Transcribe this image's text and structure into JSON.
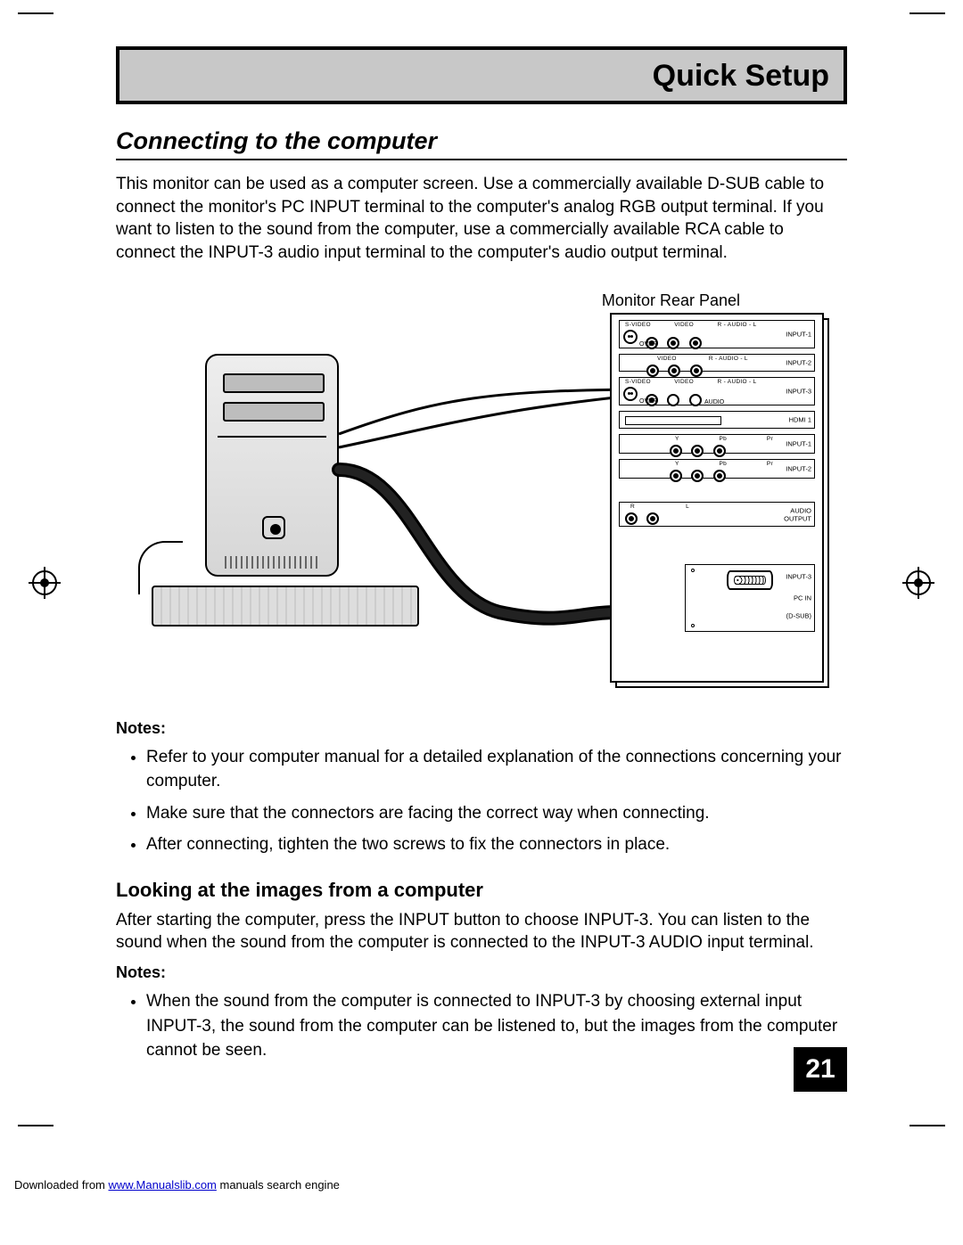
{
  "title_bar": "Quick Setup",
  "heading1": "Connecting to the computer",
  "intro": "This monitor can be used as a computer screen.  Use a commercially available D-SUB cable to connect the monitor's PC INPUT terminal to the computer's analog RGB output terminal.  If you want to listen to the sound from the computer, use a commercially available RCA cable to connect the INPUT-3 audio input terminal to the computer's audio output terminal.",
  "diagram_caption": "Monitor Rear Panel",
  "panel": {
    "row1": {
      "labels": [
        "S-VIDEO",
        "VIDEO",
        "R - AUDIO - L"
      ],
      "right": "INPUT-1",
      "sub": "OVER"
    },
    "row2": {
      "labels": [
        "VIDEO",
        "R - AUDIO - L"
      ],
      "right": "INPUT-2"
    },
    "row3": {
      "labels": [
        "S-VIDEO",
        "VIDEO",
        "R - AUDIO - L"
      ],
      "right": "INPUT-3",
      "sub": "OVER",
      "sub2": "AUDIO"
    },
    "row4": {
      "right": "HDMI 1"
    },
    "row5": {
      "labels": [
        "Y",
        "Pb",
        "Pr"
      ],
      "right": "INPUT-1"
    },
    "row6": {
      "labels": [
        "Y",
        "Pb",
        "Pr"
      ],
      "right": "INPUT-2"
    },
    "row7": {
      "labels": [
        "R",
        "L"
      ],
      "right1": "AUDIO",
      "right2": "OUTPUT"
    },
    "row8": {
      "right1": "INPUT-3",
      "right2": "PC IN",
      "right3": "(D-SUB)"
    }
  },
  "notes_label": "Notes:",
  "notes1": [
    "Refer to your computer manual for a detailed explanation of the connections concerning your computer.",
    "Make sure that the connectors are facing the correct way when connecting.",
    "After connecting, tighten the two screws to fix the connectors in place."
  ],
  "heading2": "Looking at the images from a computer",
  "body2": "After starting the computer, press the INPUT button to choose INPUT-3.  You can listen to the sound when the sound from the computer is connected to the INPUT-3 AUDIO input terminal.",
  "notes2": [
    "When the sound from the computer is connected to INPUT-3 by choosing external input INPUT-3, the sound from the computer can be listened to, but the images from the computer cannot be seen."
  ],
  "page_number": "21",
  "footer_prefix": "Downloaded from ",
  "footer_link": "www.Manualslib.com",
  "footer_suffix": " manuals search engine"
}
